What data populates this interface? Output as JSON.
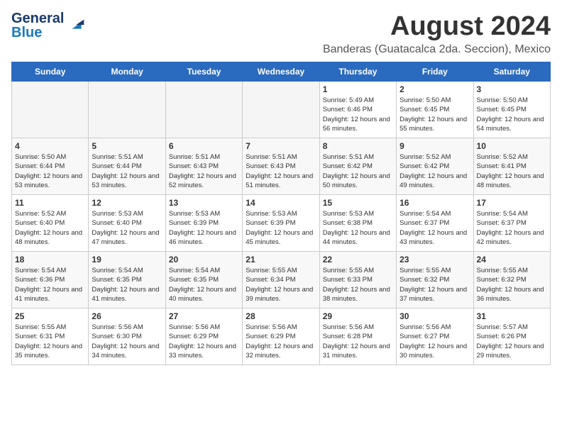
{
  "logo": {
    "line1": "General",
    "line2": "Blue"
  },
  "title": "August 2024",
  "subtitle": "Banderas (Guatacalca 2da. Seccion), Mexico",
  "weekdays": [
    "Sunday",
    "Monday",
    "Tuesday",
    "Wednesday",
    "Thursday",
    "Friday",
    "Saturday"
  ],
  "weeks": [
    [
      {
        "day": "",
        "empty": true
      },
      {
        "day": "",
        "empty": true
      },
      {
        "day": "",
        "empty": true
      },
      {
        "day": "",
        "empty": true
      },
      {
        "day": "1",
        "sunrise": "5:49 AM",
        "sunset": "6:46 PM",
        "daylight": "12 hours and 56 minutes."
      },
      {
        "day": "2",
        "sunrise": "5:50 AM",
        "sunset": "6:45 PM",
        "daylight": "12 hours and 55 minutes."
      },
      {
        "day": "3",
        "sunrise": "5:50 AM",
        "sunset": "6:45 PM",
        "daylight": "12 hours and 54 minutes."
      }
    ],
    [
      {
        "day": "4",
        "sunrise": "5:50 AM",
        "sunset": "6:44 PM",
        "daylight": "12 hours and 53 minutes."
      },
      {
        "day": "5",
        "sunrise": "5:51 AM",
        "sunset": "6:44 PM",
        "daylight": "12 hours and 53 minutes."
      },
      {
        "day": "6",
        "sunrise": "5:51 AM",
        "sunset": "6:43 PM",
        "daylight": "12 hours and 52 minutes."
      },
      {
        "day": "7",
        "sunrise": "5:51 AM",
        "sunset": "6:43 PM",
        "daylight": "12 hours and 51 minutes."
      },
      {
        "day": "8",
        "sunrise": "5:51 AM",
        "sunset": "6:42 PM",
        "daylight": "12 hours and 50 minutes."
      },
      {
        "day": "9",
        "sunrise": "5:52 AM",
        "sunset": "6:42 PM",
        "daylight": "12 hours and 49 minutes."
      },
      {
        "day": "10",
        "sunrise": "5:52 AM",
        "sunset": "6:41 PM",
        "daylight": "12 hours and 48 minutes."
      }
    ],
    [
      {
        "day": "11",
        "sunrise": "5:52 AM",
        "sunset": "6:40 PM",
        "daylight": "12 hours and 48 minutes."
      },
      {
        "day": "12",
        "sunrise": "5:53 AM",
        "sunset": "6:40 PM",
        "daylight": "12 hours and 47 minutes."
      },
      {
        "day": "13",
        "sunrise": "5:53 AM",
        "sunset": "6:39 PM",
        "daylight": "12 hours and 46 minutes."
      },
      {
        "day": "14",
        "sunrise": "5:53 AM",
        "sunset": "6:39 PM",
        "daylight": "12 hours and 45 minutes."
      },
      {
        "day": "15",
        "sunrise": "5:53 AM",
        "sunset": "6:38 PM",
        "daylight": "12 hours and 44 minutes."
      },
      {
        "day": "16",
        "sunrise": "5:54 AM",
        "sunset": "6:37 PM",
        "daylight": "12 hours and 43 minutes."
      },
      {
        "day": "17",
        "sunrise": "5:54 AM",
        "sunset": "6:37 PM",
        "daylight": "12 hours and 42 minutes."
      }
    ],
    [
      {
        "day": "18",
        "sunrise": "5:54 AM",
        "sunset": "6:36 PM",
        "daylight": "12 hours and 41 minutes."
      },
      {
        "day": "19",
        "sunrise": "5:54 AM",
        "sunset": "6:35 PM",
        "daylight": "12 hours and 41 minutes."
      },
      {
        "day": "20",
        "sunrise": "5:54 AM",
        "sunset": "6:35 PM",
        "daylight": "12 hours and 40 minutes."
      },
      {
        "day": "21",
        "sunrise": "5:55 AM",
        "sunset": "6:34 PM",
        "daylight": "12 hours and 39 minutes."
      },
      {
        "day": "22",
        "sunrise": "5:55 AM",
        "sunset": "6:33 PM",
        "daylight": "12 hours and 38 minutes."
      },
      {
        "day": "23",
        "sunrise": "5:55 AM",
        "sunset": "6:32 PM",
        "daylight": "12 hours and 37 minutes."
      },
      {
        "day": "24",
        "sunrise": "5:55 AM",
        "sunset": "6:32 PM",
        "daylight": "12 hours and 36 minutes."
      }
    ],
    [
      {
        "day": "25",
        "sunrise": "5:55 AM",
        "sunset": "6:31 PM",
        "daylight": "12 hours and 35 minutes."
      },
      {
        "day": "26",
        "sunrise": "5:56 AM",
        "sunset": "6:30 PM",
        "daylight": "12 hours and 34 minutes."
      },
      {
        "day": "27",
        "sunrise": "5:56 AM",
        "sunset": "6:29 PM",
        "daylight": "12 hours and 33 minutes."
      },
      {
        "day": "28",
        "sunrise": "5:56 AM",
        "sunset": "6:29 PM",
        "daylight": "12 hours and 32 minutes."
      },
      {
        "day": "29",
        "sunrise": "5:56 AM",
        "sunset": "6:28 PM",
        "daylight": "12 hours and 31 minutes."
      },
      {
        "day": "30",
        "sunrise": "5:56 AM",
        "sunset": "6:27 PM",
        "daylight": "12 hours and 30 minutes."
      },
      {
        "day": "31",
        "sunrise": "5:57 AM",
        "sunset": "6:26 PM",
        "daylight": "12 hours and 29 minutes."
      }
    ]
  ],
  "labels": {
    "sunrise": "Sunrise:",
    "sunset": "Sunset:",
    "daylight": "Daylight:"
  }
}
